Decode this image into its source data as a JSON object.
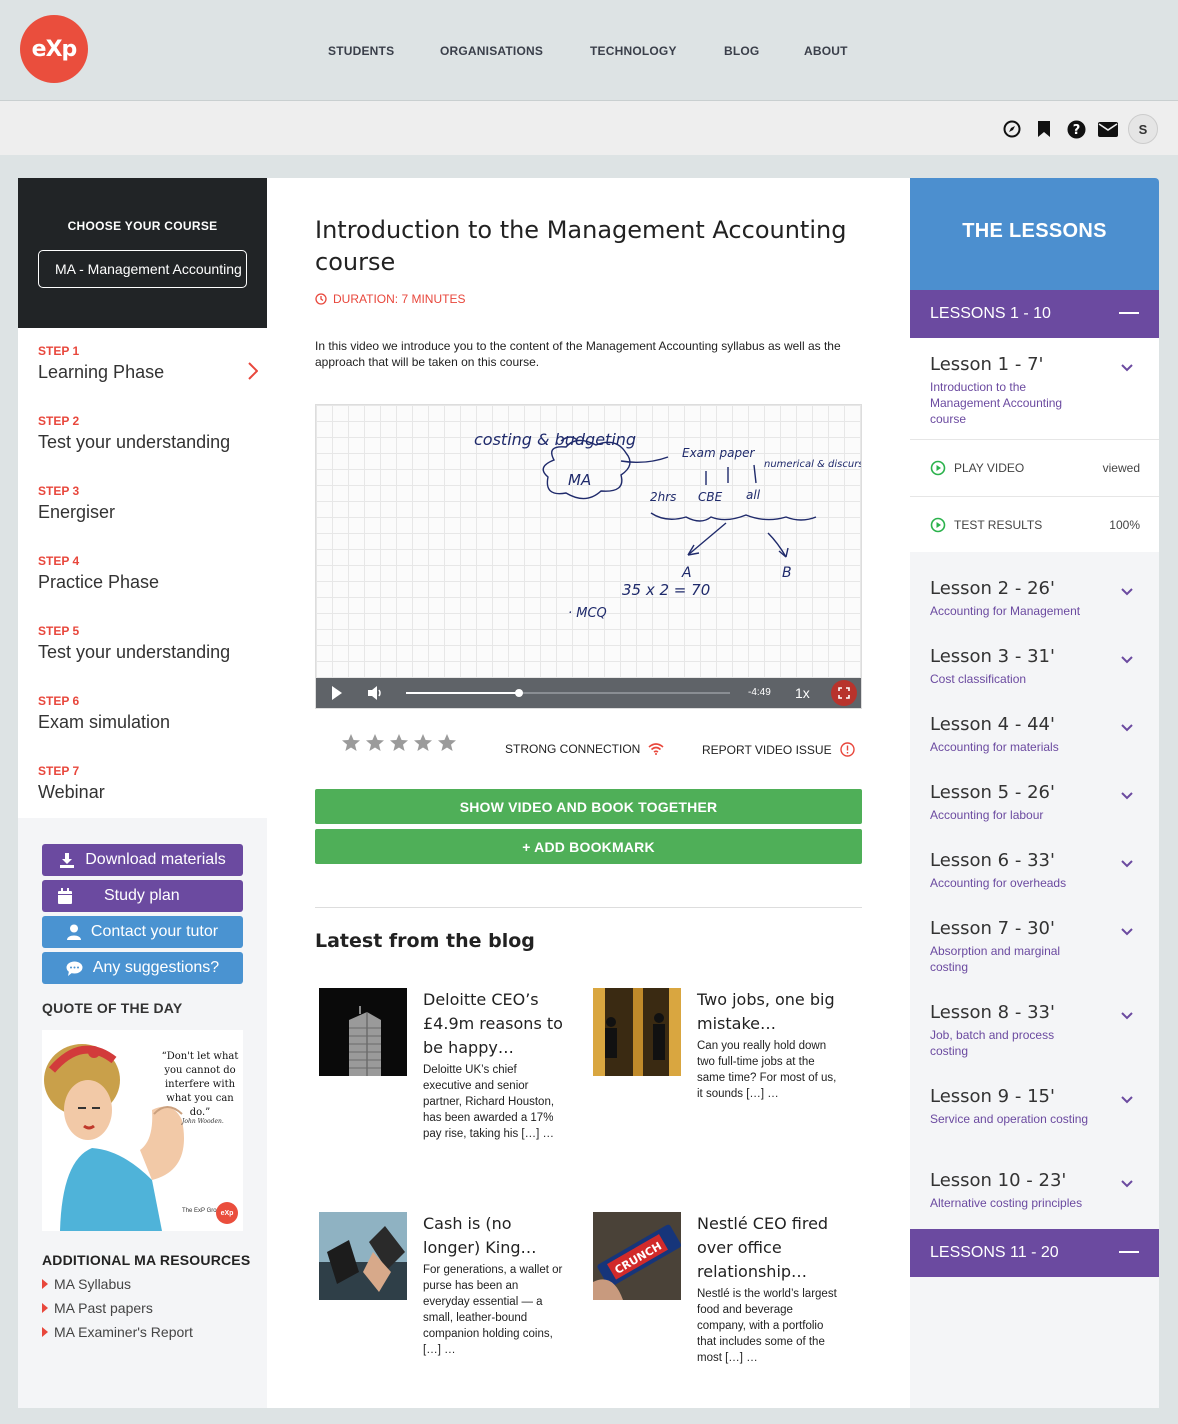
{
  "brand": {
    "logo_text": "eXp",
    "accent": "#ea4e3d",
    "purple": "#6b4aa0",
    "blue": "#4c8fcf",
    "green": "#4faf58"
  },
  "nav": [
    "STUDENTS",
    "ORGANISATIONS",
    "TECHNOLOGY",
    "BLOG",
    "ABOUT"
  ],
  "user_icons": [
    "compass-icon",
    "bookmark-icon",
    "help-icon",
    "mail-icon"
  ],
  "user": {
    "initial": "S"
  },
  "sidebar": {
    "choose_label": "CHOOSE YOUR COURSE",
    "course_value": "MA - Management Accounting",
    "steps": [
      {
        "label": "STEP 1",
        "name": "Learning Phase"
      },
      {
        "label": "STEP 2",
        "name": "Test your understanding"
      },
      {
        "label": "STEP 3",
        "name": "Energiser"
      },
      {
        "label": "STEP 4",
        "name": "Practice Phase"
      },
      {
        "label": "STEP 5",
        "name": "Test your understanding"
      },
      {
        "label": "STEP 6",
        "name": "Exam simulation"
      },
      {
        "label": "STEP 7",
        "name": "Webinar"
      }
    ],
    "buttons": [
      "Download materials",
      "Study plan",
      "Contact your tutor",
      "Any suggestions?"
    ],
    "quote_title": "QUOTE OF THE DAY",
    "quote": {
      "text": "“Don't let what you cannot do interfere with what you can do.”",
      "author": "John Wooden.",
      "credit": "The ExP Group"
    },
    "resources_title": "ADDITIONAL MA RESOURCES",
    "resources": [
      "MA Syllabus",
      "MA Past papers",
      "MA Examiner's Report"
    ]
  },
  "main": {
    "title": "Introduction to the Management Accounting course",
    "duration": "DURATION: 7 MINUTES",
    "intro": "In this video we introduce you to the content of the Management Accounting syllabus as well as the approach that will be taken on this course.",
    "video": {
      "time": "-4:49",
      "rate": "1x",
      "progress": 0.35,
      "whiteboard": [
        "costing & budgeting",
        "MA",
        "Exam paper",
        "numerical & discursive",
        "2hrs",
        "CBE",
        "all",
        "A",
        "B",
        "35 x 2 = 70",
        "· MCQ"
      ]
    },
    "rating": {
      "stars": 5,
      "filled": 0
    },
    "connection": "STRONG CONNECTION",
    "report": "REPORT VIDEO ISSUE",
    "show_together": "SHOW VIDEO AND BOOK TOGETHER",
    "add_bookmark": "+ ADD BOOKMARK",
    "blog_title": "Latest from the blog",
    "posts": [
      {
        "title": "Deloitte CEO’s £4.9m reasons to be happy…",
        "desc": "Deloitte UK’s chief executive and senior partner, Richard Houston, has been awarded a 17% pay rise, taking his […] …"
      },
      {
        "title": "Two jobs, one big mistake…",
        "desc": "Can you really hold down two full-time jobs at the same time? For most of us, it sounds […] …"
      },
      {
        "title": "Cash is (no longer) King…",
        "desc": "For generations, a wallet or purse has been an everyday essential — a small, leather-bound companion holding coins, […] …"
      },
      {
        "title": "Nestlé CEO fired over office relationship…",
        "desc": "Nestlé is the world’s largest food and beverage company, with a portfolio that includes some of the most […] …"
      }
    ],
    "post3_thumb_text": "CRUNCH"
  },
  "lessons": {
    "header": "THE LESSONS",
    "group1": "LESSONS 1 - 10",
    "group2": "LESSONS 11 - 20",
    "play_video": "PLAY VIDEO",
    "play_status": "viewed",
    "test_results": "TEST RESULTS",
    "test_score": "100%",
    "items": [
      {
        "title": "Lesson 1 - 7'",
        "sub": "Introduction to the Management Accounting course"
      },
      {
        "title": "Lesson 2 - 26'",
        "sub": "Accounting for Management"
      },
      {
        "title": "Lesson 3 - 31'",
        "sub": "Cost classification"
      },
      {
        "title": "Lesson 4 - 44'",
        "sub": "Accounting for materials"
      },
      {
        "title": "Lesson 5 - 26'",
        "sub": "Accounting for labour"
      },
      {
        "title": "Lesson 6 - 33'",
        "sub": "Accounting for overheads"
      },
      {
        "title": "Lesson 7 - 30'",
        "sub": "Absorption and marginal costing"
      },
      {
        "title": "Lesson 8 - 33'",
        "sub": "Job, batch and process costing"
      },
      {
        "title": "Lesson 9 - 15'",
        "sub": "Service and operation costing"
      },
      {
        "title": "Lesson 10 - 23'",
        "sub": "Alternative costing principles"
      }
    ]
  }
}
